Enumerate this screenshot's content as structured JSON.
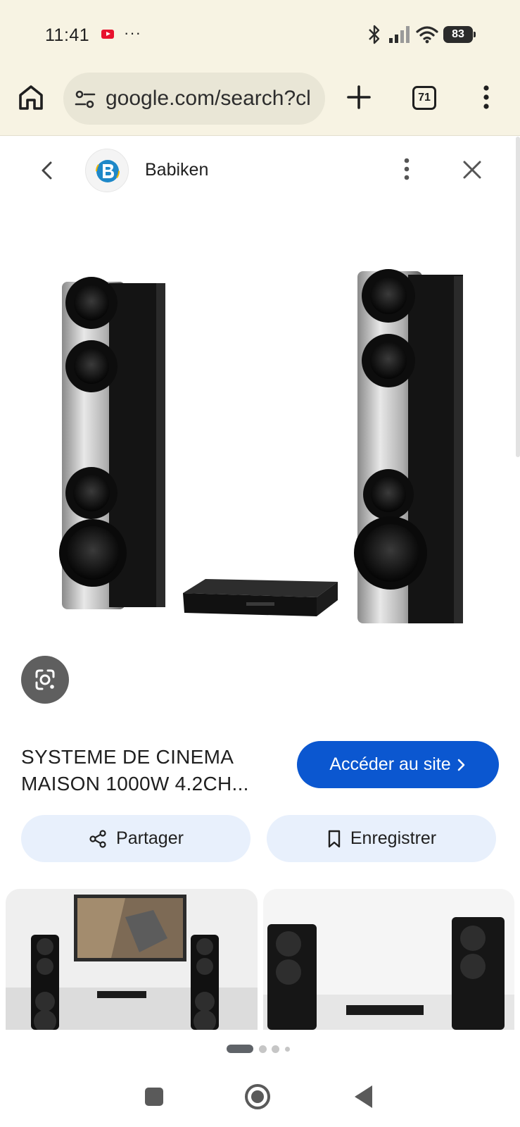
{
  "status_bar": {
    "time": "11:41",
    "notification_dots": "···",
    "battery": "83"
  },
  "browser": {
    "url": "google.com/search?cl",
    "tab_count": "71"
  },
  "viewer": {
    "site_name": "Babiken",
    "product_title": "SYSTEME DE CINEMA MAISON 1000W 4.2CH...",
    "visit_label": "Accéder au site",
    "share_label": "Partager",
    "save_label": "Enregistrer"
  },
  "icons": {
    "home": "home-icon",
    "tune": "tune-icon",
    "new_tab": "plus-icon",
    "menu": "more-vert-icon",
    "back": "chevron-left-icon",
    "close": "close-icon",
    "lens": "google-lens-icon",
    "share": "share-icon",
    "save": "bookmark-icon"
  },
  "colors": {
    "accent": "#0b57d0",
    "chip_background": "#e8f0fc",
    "chrome_background": "#f7f3e3"
  },
  "pager": {
    "page_count": 4,
    "active_page": 1
  }
}
